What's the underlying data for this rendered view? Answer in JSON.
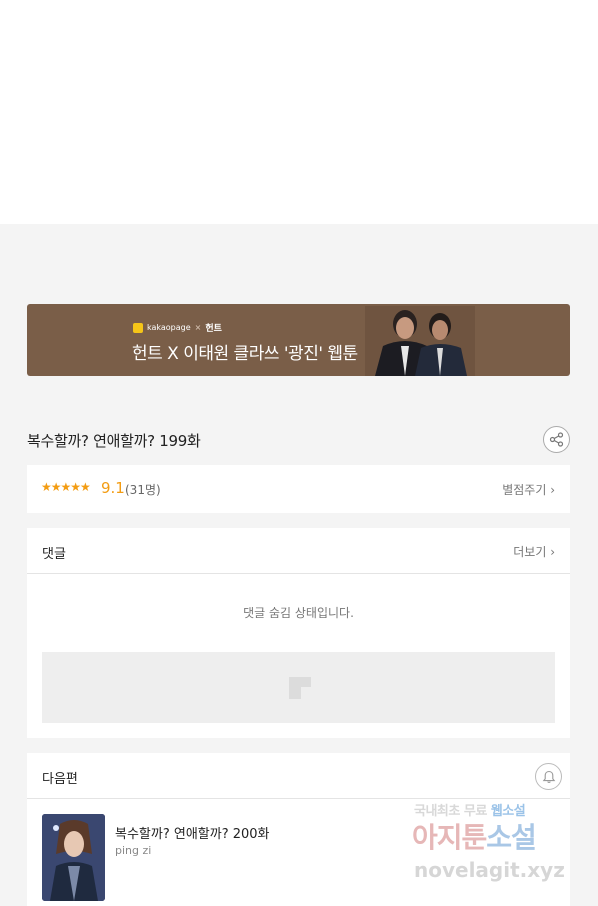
{
  "banner": {
    "brand": "kakaopage",
    "separator": "×",
    "partner": "헌트",
    "title": "헌트 X 이태원 클라쓰 '광진' 웹툰"
  },
  "episode": {
    "title": "복수할까? 연애할까? 199화"
  },
  "rating": {
    "stars": "★★★★★",
    "score": "9.1",
    "count": "(31명)",
    "rate_link": "별점주기 ›"
  },
  "comments": {
    "title": "댓글",
    "more": "더보기 ›",
    "hidden_message": "댓글 숨김 상태입니다."
  },
  "next": {
    "header": "다음편",
    "title": "복수할까? 연애할까? 200화",
    "author": "ping zi"
  },
  "watermark": {
    "line1_a": "국내최초 무료 ",
    "line1_b": "웹소설",
    "line2_a": "아지툰",
    "line2_b": "소설",
    "line3": "novelagit.xyz"
  },
  "colors": {
    "banner_bg": "#7a5e48",
    "star": "#f39c12",
    "page_bg": "#f4f4f4"
  }
}
